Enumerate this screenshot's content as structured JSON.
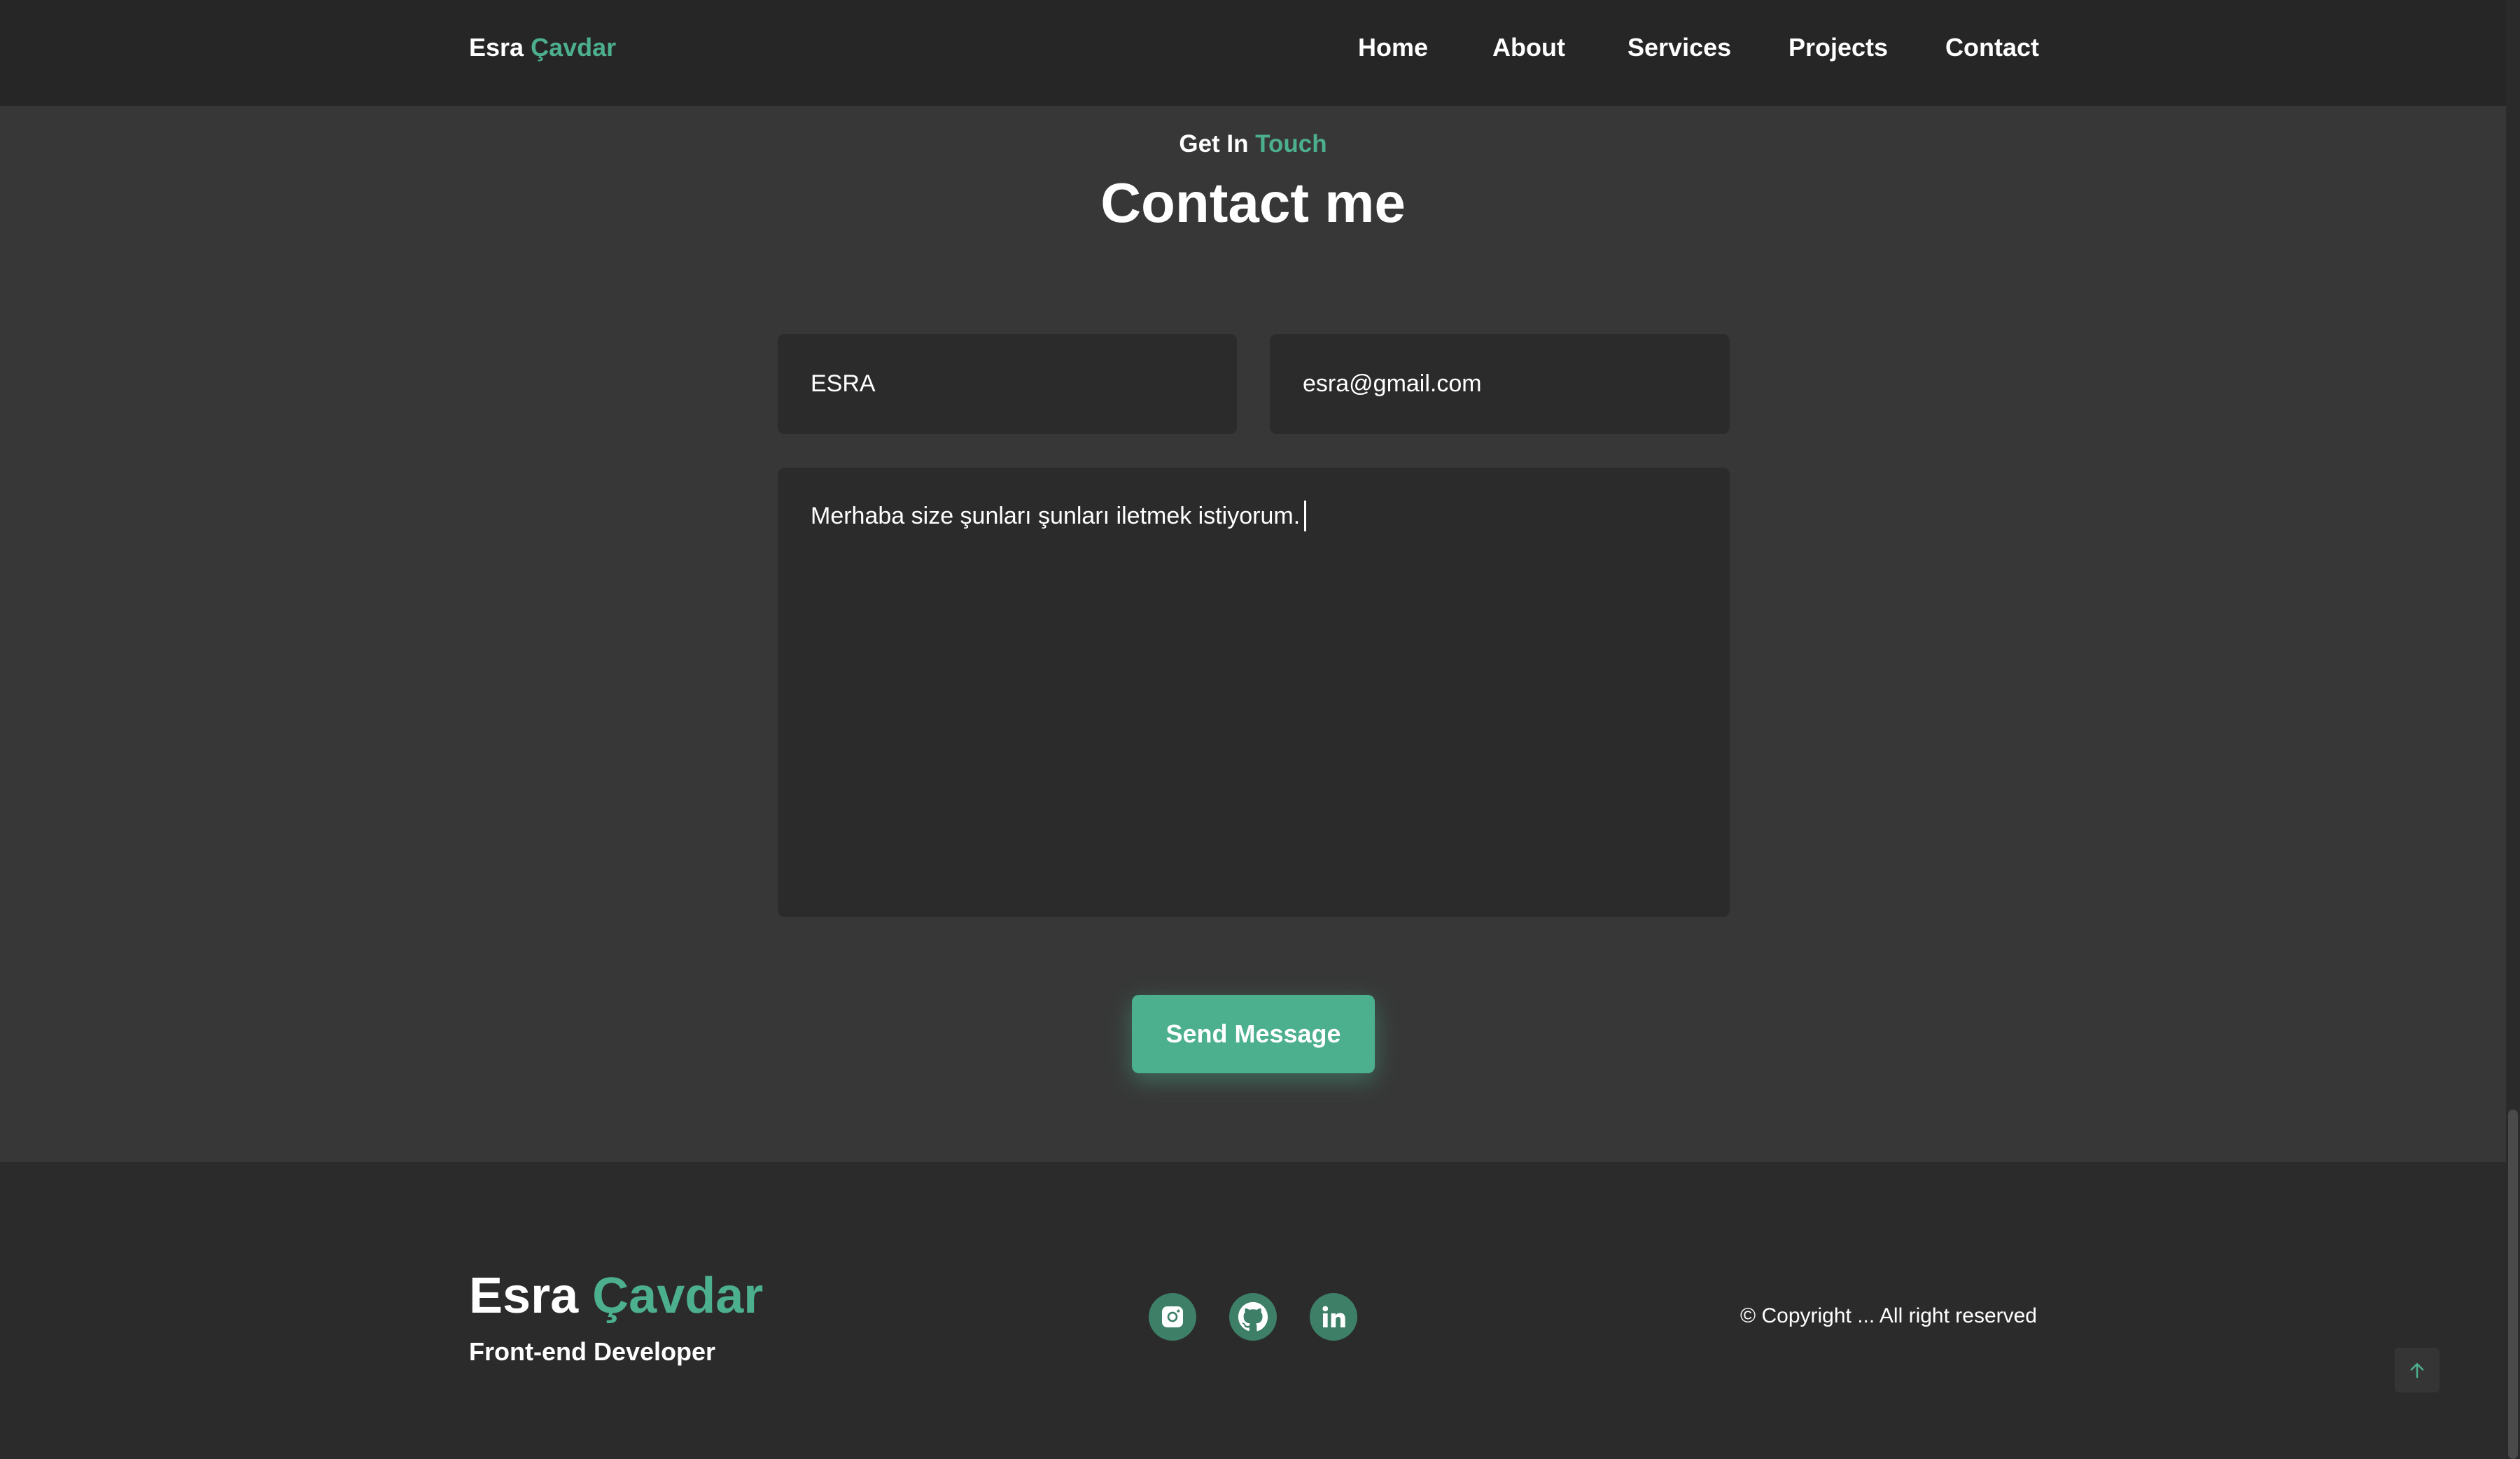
{
  "header": {
    "brand_first": "Esra",
    "brand_accent": "Çavdar",
    "nav": {
      "home": "Home",
      "about": "About",
      "services": "Services",
      "projects": "Projects",
      "contact": "Contact"
    }
  },
  "contact": {
    "eyebrow_prefix": "Get In",
    "eyebrow_accent": "Touch",
    "title": "Contact me",
    "name_value": "ESRA",
    "email_value": "esra@gmail.com",
    "message_value": "Merhaba size şunları şunları iletmek istiyorum.",
    "send_label": "Send Message"
  },
  "footer": {
    "brand_first": "Esra",
    "brand_accent": "Çavdar",
    "tagline": "Front-end Developer",
    "social": [
      {
        "icon": "instagram-icon"
      },
      {
        "icon": "github-icon"
      },
      {
        "icon": "linkedin-icon"
      }
    ],
    "copyright": "© Copyright ... All right reserved",
    "to_top_icon": "arrow-up-icon"
  },
  "colors": {
    "accent": "#4caf8e",
    "background": "#373737",
    "header_bg": "#262626",
    "footer_bg": "#2b2b2b",
    "field_bg": "#2b2b2b",
    "social_bg": "#3d7f67"
  }
}
